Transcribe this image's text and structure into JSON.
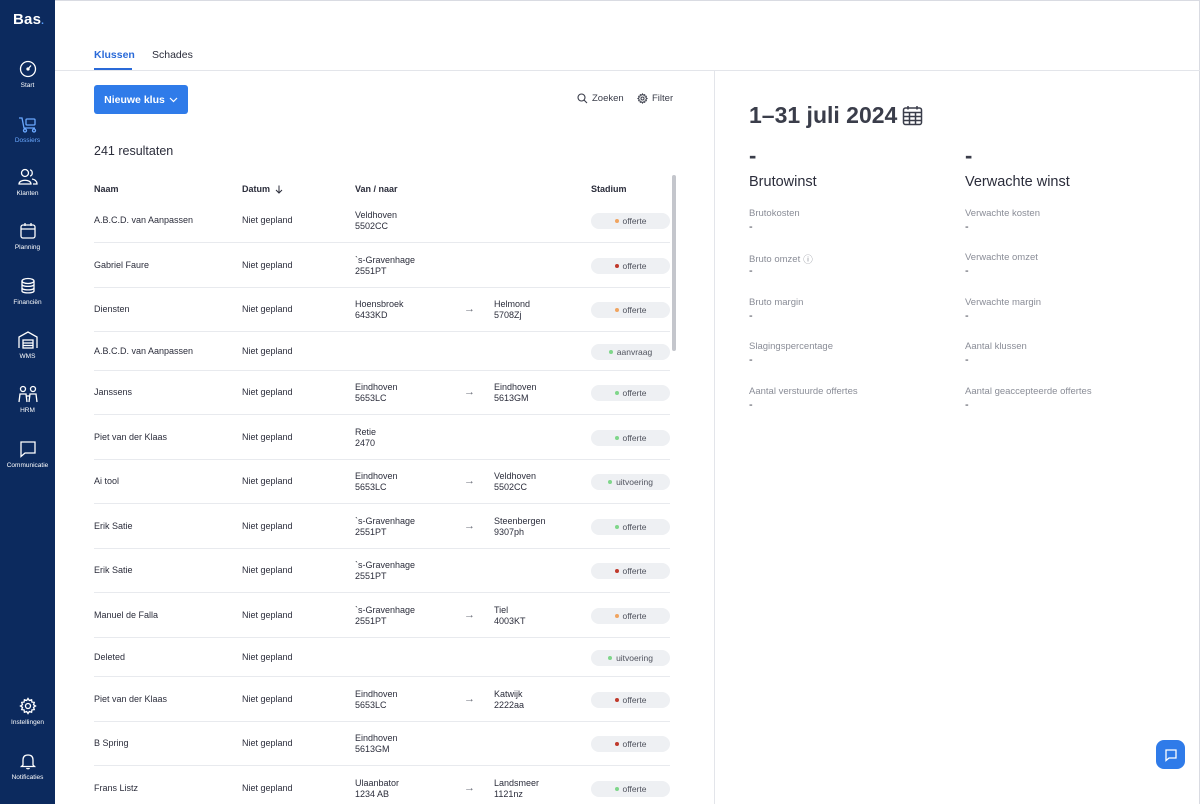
{
  "sidebar": {
    "logo": "Bas",
    "logo_dot": ".",
    "items": [
      {
        "label": "Start"
      },
      {
        "label": "Dossiers"
      },
      {
        "label": "Klanten"
      },
      {
        "label": "Planning"
      },
      {
        "label": "Financiën"
      },
      {
        "label": "WMS"
      },
      {
        "label": "HRM"
      },
      {
        "label": "Communicatie"
      },
      {
        "label": "Instellingen"
      },
      {
        "label": "Notificaties"
      }
    ]
  },
  "tabs": [
    {
      "label": "Klussen"
    },
    {
      "label": "Schades"
    }
  ],
  "toolbar": {
    "new_button": "Nieuwe klus",
    "search": "Zoeken",
    "filter": "Filter"
  },
  "results_count": "241 resultaten",
  "table": {
    "headers": {
      "name": "Naam",
      "date": "Datum",
      "route": "Van / naar",
      "stage": "Stadium"
    },
    "rows": [
      {
        "name": "A.B.C.D. van Aanpassen",
        "date": "Niet gepland",
        "from_city": "Veldhoven",
        "from_code": "5502CC",
        "to_city": "",
        "to_code": "",
        "arrow": "",
        "stage": "offerte",
        "dot": "#f0a460"
      },
      {
        "name": "Gabriel Faure",
        "date": "Niet gepland",
        "from_city": "`s-Gravenhage",
        "from_code": "2551PT",
        "to_city": "",
        "to_code": "",
        "arrow": "",
        "stage": "offerte",
        "dot": "#c0392b"
      },
      {
        "name": "Diensten",
        "date": "Niet gepland",
        "from_city": "Hoensbroek",
        "from_code": "6433KD",
        "to_city": "Helmond",
        "to_code": "5708Zj",
        "arrow": "→",
        "stage": "offerte",
        "dot": "#f0a460"
      },
      {
        "name": "A.B.C.D. van Aanpassen",
        "date": "Niet gepland",
        "from_city": "",
        "from_code": "",
        "to_city": "",
        "to_code": "",
        "arrow": "",
        "stage": "aanvraag",
        "dot": "#7fd68a"
      },
      {
        "name": "Janssens",
        "date": "Niet gepland",
        "from_city": "Eindhoven",
        "from_code": "5653LC",
        "to_city": "Eindhoven",
        "to_code": "5613GM",
        "arrow": "→",
        "stage": "offerte",
        "dot": "#7fd68a"
      },
      {
        "name": "Piet van der Klaas",
        "date": "Niet gepland",
        "from_city": "Retie",
        "from_code": "2470",
        "to_city": "",
        "to_code": "",
        "arrow": "",
        "stage": "offerte",
        "dot": "#7fd68a"
      },
      {
        "name": "Ai tool",
        "date": "Niet gepland",
        "from_city": "Eindhoven",
        "from_code": "5653LC",
        "to_city": "Veldhoven",
        "to_code": "5502CC",
        "arrow": "→",
        "stage": "uitvoering",
        "dot": "#7fd68a"
      },
      {
        "name": "Erik Satie",
        "date": "Niet gepland",
        "from_city": "`s-Gravenhage",
        "from_code": "2551PT",
        "to_city": "Steenbergen",
        "to_code": "9307ph",
        "arrow": "→",
        "stage": "offerte",
        "dot": "#7fd68a"
      },
      {
        "name": "Erik Satie",
        "date": "Niet gepland",
        "from_city": "`s-Gravenhage",
        "from_code": "2551PT",
        "to_city": "",
        "to_code": "",
        "arrow": "",
        "stage": "offerte",
        "dot": "#c0392b"
      },
      {
        "name": "Manuel de Falla",
        "date": "Niet gepland",
        "from_city": "`s-Gravenhage",
        "from_code": "2551PT",
        "to_city": "Tiel",
        "to_code": "4003KT",
        "arrow": "→",
        "stage": "offerte",
        "dot": "#f0a460"
      },
      {
        "name": "Deleted",
        "date": "Niet gepland",
        "from_city": "",
        "from_code": "",
        "to_city": "",
        "to_code": "",
        "arrow": "",
        "stage": "uitvoering",
        "dot": "#7fd68a"
      },
      {
        "name": "Piet van der Klaas",
        "date": "Niet gepland",
        "from_city": "Eindhoven",
        "from_code": "5653LC",
        "to_city": "Katwijk",
        "to_code": "2222aa",
        "arrow": "→",
        "stage": "offerte",
        "dot": "#c0392b"
      },
      {
        "name": "B Spring",
        "date": "Niet gepland",
        "from_city": "Eindhoven",
        "from_code": "5613GM",
        "to_city": "",
        "to_code": "",
        "arrow": "",
        "stage": "offerte",
        "dot": "#c0392b"
      },
      {
        "name": "Frans Listz",
        "date": "Niet gepland",
        "from_city": "Ulaanbator",
        "from_code": "1234 AB",
        "to_city": "Landsmeer",
        "to_code": "1121nz",
        "arrow": "→",
        "stage": "offerte",
        "dot": "#7fd68a"
      }
    ]
  },
  "stats": {
    "period": "1–31 juli 2024",
    "columns": [
      {
        "big_value": "-",
        "heading": "Brutowinst",
        "items": [
          {
            "label": "Brutokosten",
            "value": "-"
          },
          {
            "label": "Bruto omzet",
            "value": "-",
            "info": "ⓘ"
          },
          {
            "label": "Bruto margin",
            "value": "-"
          },
          {
            "label": "Slagingspercentage",
            "value": "-"
          },
          {
            "label": "Aantal verstuurde offertes",
            "value": "-"
          }
        ]
      },
      {
        "big_value": "-",
        "heading": "Verwachte winst",
        "items": [
          {
            "label": "Verwachte kosten",
            "value": "-"
          },
          {
            "label": "Verwachte omzet",
            "value": "-"
          },
          {
            "label": "Verwachte margin",
            "value": "-"
          },
          {
            "label": "Aantal klussen",
            "value": "-"
          },
          {
            "label": "Aantal geaccepteerde offertes",
            "value": "-"
          }
        ]
      }
    ]
  },
  "colors": {
    "sidebar_bg": "#0c2a5e",
    "accent": "#2f7be9",
    "dot_orange": "#f0a460",
    "dot_red": "#c0392b",
    "dot_green": "#7fd68a"
  }
}
